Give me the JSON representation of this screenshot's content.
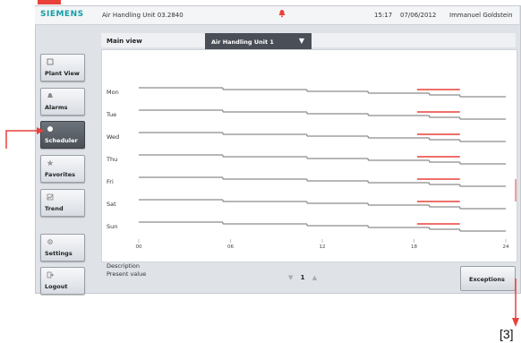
{
  "header": {
    "brand": "SIEMENS",
    "unit_name": "Air Handling Unit 03.2840",
    "time": "15:17",
    "date": "07/06/2012",
    "user": "Immanuel Goldstein"
  },
  "nav": [
    {
      "label": "Plant View",
      "icon": "plant-view-icon"
    },
    {
      "label": "Alarms",
      "icon": "bell-icon"
    },
    {
      "label": "Scheduler",
      "icon": "clock-icon",
      "active": true
    },
    {
      "label": "Favorites",
      "icon": "star-icon"
    },
    {
      "label": "Trend",
      "icon": "trend-icon"
    },
    {
      "label": "Settings",
      "icon": "gear-icon"
    },
    {
      "label": "Logout",
      "icon": "logout-icon"
    }
  ],
  "main": {
    "title": "Main view",
    "dropdown_value": "Air Handling Unit 1",
    "description": "Description",
    "present_value": "Present value",
    "page": "1",
    "exceptions_label": "Exceptions"
  },
  "schedule": {
    "days": [
      "Mon",
      "Tue",
      "Wed",
      "Thu",
      "Fri",
      "Sat",
      "Sun"
    ],
    "x_ticks": [
      "00",
      "06",
      "12",
      "18",
      "24"
    ],
    "exception_color": "#e8413a",
    "line_color": "#8c8c8c"
  },
  "annotation": {
    "label": "[3]",
    "color": "#e8413a"
  }
}
